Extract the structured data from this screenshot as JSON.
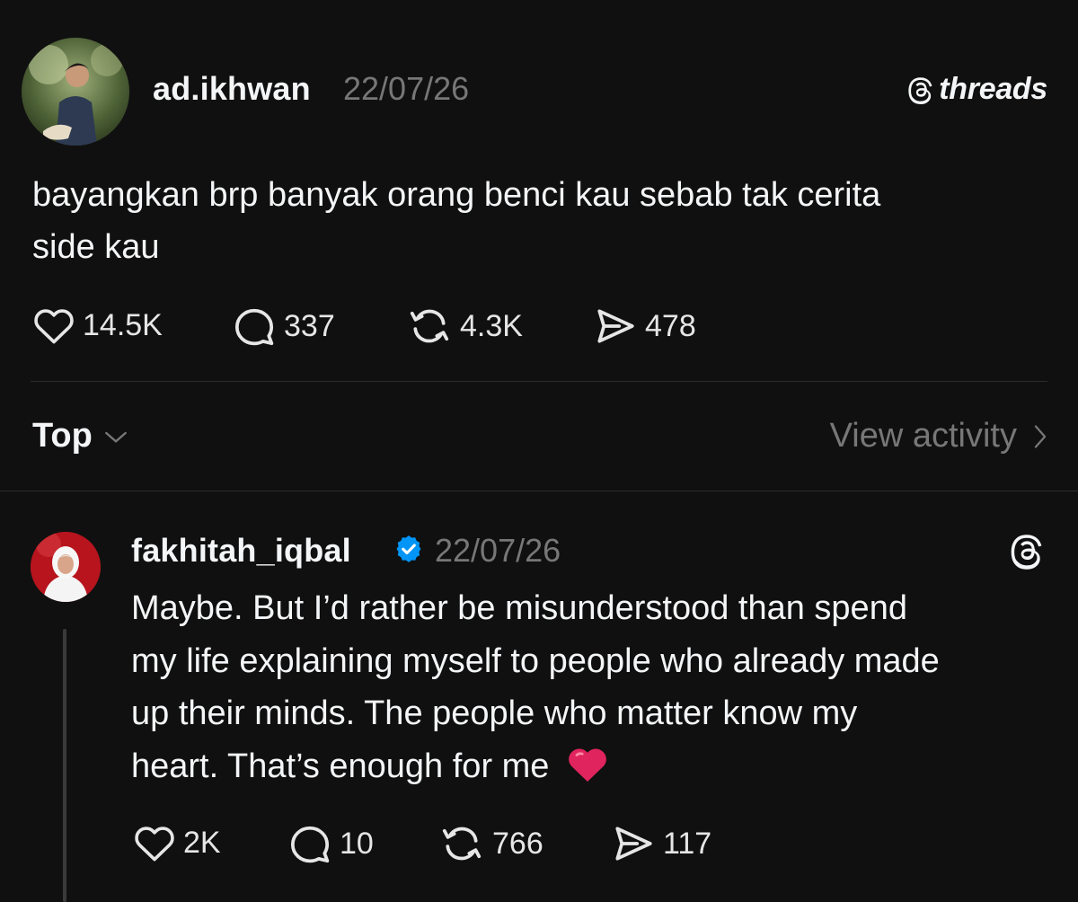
{
  "post": {
    "username": "ad.ikhwan",
    "timestamp": "22/07/26",
    "brand": "threads",
    "text_line1": "bayangkan brp banyak orang benci kau sebab tak cerita",
    "text_line2": "side kau",
    "likes": "14.5K",
    "comments": "337",
    "reposts": "4.3K",
    "shares": "478"
  },
  "sort": {
    "label": "Top",
    "view_activity": "View activity"
  },
  "reply": {
    "username": "fakhitah_iqbal",
    "timestamp": "22/07/26",
    "verified": true,
    "text_line1": "Maybe. But I’d rather be misunderstood than spend",
    "text_line2": "my life explaining myself to people who already made",
    "text_line3": "up their minds. The people who matter know my",
    "text_line4": "heart. That’s enough for me",
    "emoji": "❤️",
    "likes": "2K",
    "comments": "10",
    "reposts": "766",
    "shares": "117"
  },
  "icons": {
    "like": "heart-icon",
    "comment": "comment-bubble-icon",
    "repost": "repost-icon",
    "share": "send-icon",
    "verified": "verified-badge-icon",
    "threads": "threads-logo-icon",
    "chevron_down": "chevron-down-icon",
    "chevron_right": "chevron-right-icon"
  },
  "colors": {
    "background": "#101010",
    "text": "#f3f5f7",
    "muted": "#777777",
    "verified": "#0095f6",
    "heart": "#e0245e"
  }
}
